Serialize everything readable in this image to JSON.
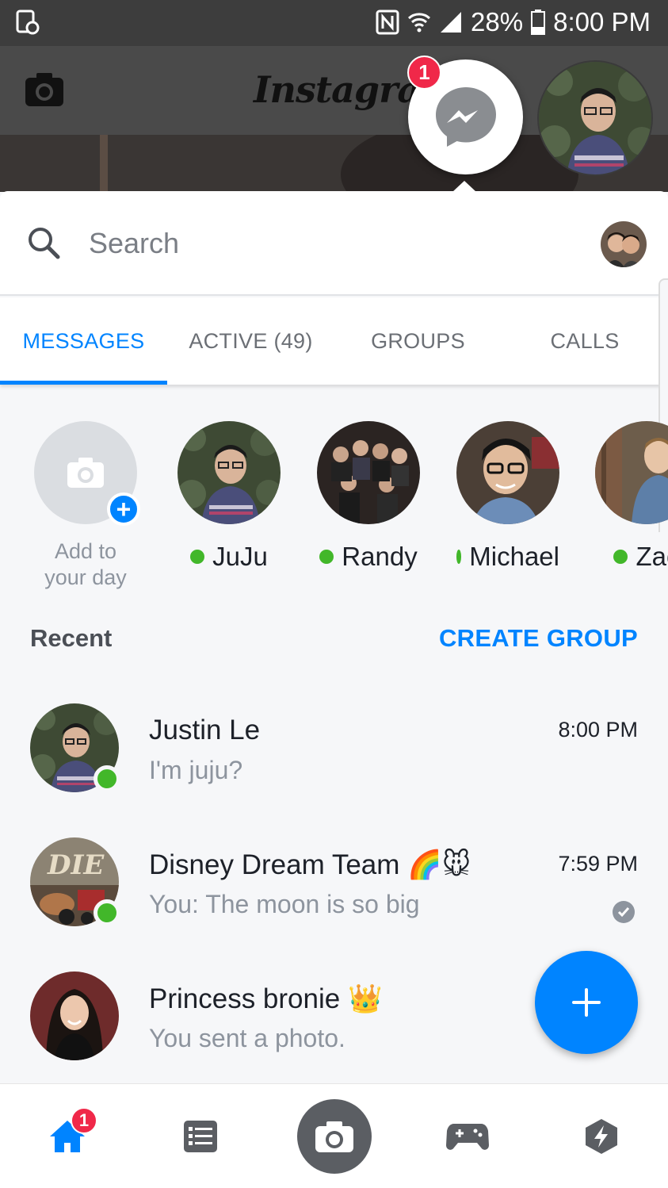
{
  "status_bar": {
    "battery": "28%",
    "time": "8:00 PM"
  },
  "background_app": {
    "logo": "Instagram"
  },
  "chat_head": {
    "badge_count": "1"
  },
  "search": {
    "placeholder": "Search"
  },
  "tabs": [
    {
      "label": "MESSAGES",
      "active": true
    },
    {
      "label": "ACTIVE (49)",
      "active": false
    },
    {
      "label": "GROUPS",
      "active": false
    },
    {
      "label": "CALLS",
      "active": false
    }
  ],
  "stories": {
    "add_label": "Add to your day",
    "active_people": [
      {
        "name": "JuJu"
      },
      {
        "name": "Randy"
      },
      {
        "name": "Michael"
      },
      {
        "name": "Zac"
      }
    ]
  },
  "recent": {
    "title": "Recent",
    "create_group": "CREATE GROUP"
  },
  "conversations": [
    {
      "title": "Justin Le",
      "emoji": "",
      "snippet": "I'm juju?",
      "time": "8:00 PM",
      "online": true,
      "seen": false
    },
    {
      "title": "Disney Dream Team",
      "emoji": "🌈🐭",
      "snippet": "You: The moon is so big",
      "time": "7:59 PM",
      "online": true,
      "seen": true
    },
    {
      "title": "Princess bronie",
      "emoji": "👑",
      "snippet": "You sent a photo.",
      "time": "",
      "online": false,
      "seen": false
    }
  ],
  "bottom_nav": {
    "home_badge": "1",
    "items": [
      "home-icon",
      "list-icon",
      "camera-icon",
      "gamepad-icon",
      "flash-icon"
    ]
  },
  "colors": {
    "accent": "#0084ff",
    "online": "#42b72a",
    "badge": "#f02849"
  }
}
